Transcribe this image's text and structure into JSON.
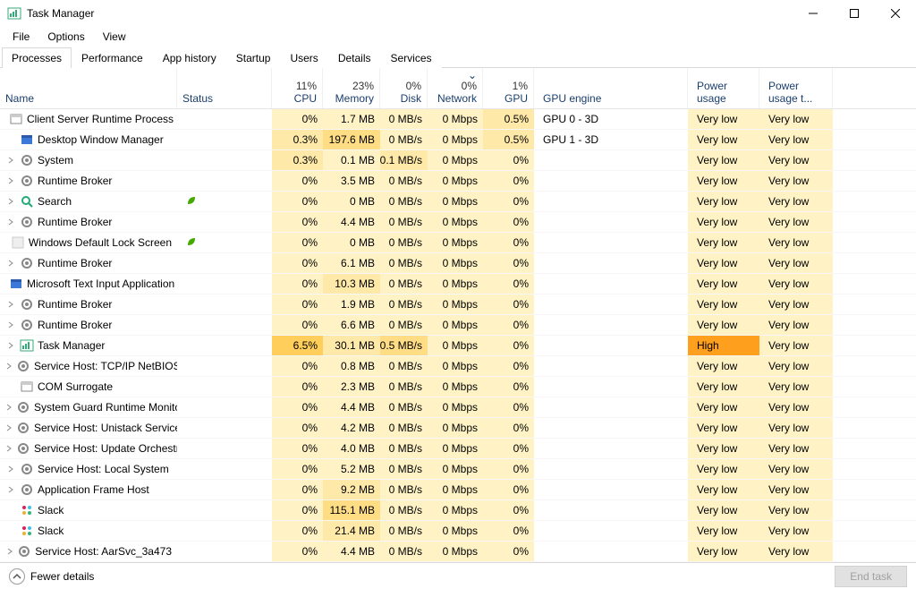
{
  "window": {
    "title": "Task Manager"
  },
  "menu": {
    "file": "File",
    "options": "Options",
    "view": "View"
  },
  "tabs": {
    "processes": "Processes",
    "performance": "Performance",
    "app_history": "App history",
    "startup": "Startup",
    "users": "Users",
    "details": "Details",
    "services": "Services"
  },
  "columns": {
    "name": "Name",
    "status": "Status",
    "cpu_pct": "11%",
    "cpu": "CPU",
    "mem_pct": "23%",
    "mem": "Memory",
    "disk_pct": "0%",
    "disk": "Disk",
    "net_pct": "0%",
    "net": "Network",
    "gpu_pct": "1%",
    "gpu": "GPU",
    "gpu_engine": "GPU engine",
    "power": "Power usage",
    "power_trend": "Power usage t..."
  },
  "footer": {
    "fewer": "Fewer details",
    "end_task": "End task"
  },
  "processes": [
    {
      "expand": false,
      "icon": "window",
      "name": "Client Server Runtime Process",
      "leaf": "",
      "cpu": "0%",
      "mem": "1.7 MB",
      "disk": "0 MB/s",
      "net": "0 Mbps",
      "gpu": "0.5%",
      "gpueng": "GPU 0 - 3D",
      "power": "Very low",
      "powertrend": "Very low",
      "cpu_h": 1,
      "mem_h": 1,
      "disk_h": 1,
      "net_h": 1,
      "gpu_h": 2,
      "power_h": 1
    },
    {
      "expand": false,
      "icon": "window-blue",
      "name": "Desktop Window Manager",
      "leaf": "",
      "cpu": "0.3%",
      "mem": "197.6 MB",
      "disk": "0 MB/s",
      "net": "0 Mbps",
      "gpu": "0.5%",
      "gpueng": "GPU 1 - 3D",
      "power": "Very low",
      "powertrend": "Very low",
      "cpu_h": 2,
      "mem_h": 3,
      "disk_h": 1,
      "net_h": 1,
      "gpu_h": 2,
      "power_h": 1
    },
    {
      "expand": true,
      "icon": "gear",
      "name": "System",
      "leaf": "",
      "cpu": "0.3%",
      "mem": "0.1 MB",
      "disk": "0.1 MB/s",
      "net": "0 Mbps",
      "gpu": "0%",
      "gpueng": "",
      "power": "Very low",
      "powertrend": "Very low",
      "cpu_h": 2,
      "mem_h": 1,
      "disk_h": 2,
      "net_h": 1,
      "gpu_h": 1,
      "power_h": 1
    },
    {
      "expand": true,
      "icon": "gear",
      "name": "Runtime Broker",
      "leaf": "",
      "cpu": "0%",
      "mem": "3.5 MB",
      "disk": "0 MB/s",
      "net": "0 Mbps",
      "gpu": "0%",
      "gpueng": "",
      "power": "Very low",
      "powertrend": "Very low",
      "cpu_h": 1,
      "mem_h": 1,
      "disk_h": 1,
      "net_h": 1,
      "gpu_h": 1,
      "power_h": 1
    },
    {
      "expand": true,
      "icon": "search",
      "name": "Search",
      "leaf": "green",
      "cpu": "0%",
      "mem": "0 MB",
      "disk": "0 MB/s",
      "net": "0 Mbps",
      "gpu": "0%",
      "gpueng": "",
      "power": "Very low",
      "powertrend": "Very low",
      "cpu_h": 1,
      "mem_h": 1,
      "disk_h": 1,
      "net_h": 1,
      "gpu_h": 1,
      "power_h": 1
    },
    {
      "expand": true,
      "icon": "gear",
      "name": "Runtime Broker",
      "leaf": "",
      "cpu": "0%",
      "mem": "4.4 MB",
      "disk": "0 MB/s",
      "net": "0 Mbps",
      "gpu": "0%",
      "gpueng": "",
      "power": "Very low",
      "powertrend": "Very low",
      "cpu_h": 1,
      "mem_h": 1,
      "disk_h": 1,
      "net_h": 1,
      "gpu_h": 1,
      "power_h": 1
    },
    {
      "expand": false,
      "icon": "blank",
      "name": "Windows Default Lock Screen",
      "leaf": "green",
      "cpu": "0%",
      "mem": "0 MB",
      "disk": "0 MB/s",
      "net": "0 Mbps",
      "gpu": "0%",
      "gpueng": "",
      "power": "Very low",
      "powertrend": "Very low",
      "cpu_h": 1,
      "mem_h": 1,
      "disk_h": 1,
      "net_h": 1,
      "gpu_h": 1,
      "power_h": 1
    },
    {
      "expand": true,
      "icon": "gear",
      "name": "Runtime Broker",
      "leaf": "",
      "cpu": "0%",
      "mem": "6.1 MB",
      "disk": "0 MB/s",
      "net": "0 Mbps",
      "gpu": "0%",
      "gpueng": "",
      "power": "Very low",
      "powertrend": "Very low",
      "cpu_h": 1,
      "mem_h": 1,
      "disk_h": 1,
      "net_h": 1,
      "gpu_h": 1,
      "power_h": 1
    },
    {
      "expand": false,
      "icon": "window-blue",
      "name": "Microsoft Text Input Application",
      "leaf": "",
      "cpu": "0%",
      "mem": "10.3 MB",
      "disk": "0 MB/s",
      "net": "0 Mbps",
      "gpu": "0%",
      "gpueng": "",
      "power": "Very low",
      "powertrend": "Very low",
      "cpu_h": 1,
      "mem_h": 2,
      "disk_h": 1,
      "net_h": 1,
      "gpu_h": 1,
      "power_h": 1
    },
    {
      "expand": true,
      "icon": "gear",
      "name": "Runtime Broker",
      "leaf": "",
      "cpu": "0%",
      "mem": "1.9 MB",
      "disk": "0 MB/s",
      "net": "0 Mbps",
      "gpu": "0%",
      "gpueng": "",
      "power": "Very low",
      "powertrend": "Very low",
      "cpu_h": 1,
      "mem_h": 1,
      "disk_h": 1,
      "net_h": 1,
      "gpu_h": 1,
      "power_h": 1
    },
    {
      "expand": true,
      "icon": "gear",
      "name": "Runtime Broker",
      "leaf": "",
      "cpu": "0%",
      "mem": "6.6 MB",
      "disk": "0 MB/s",
      "net": "0 Mbps",
      "gpu": "0%",
      "gpueng": "",
      "power": "Very low",
      "powertrend": "Very low",
      "cpu_h": 1,
      "mem_h": 1,
      "disk_h": 1,
      "net_h": 1,
      "gpu_h": 1,
      "power_h": 1
    },
    {
      "expand": true,
      "icon": "taskmgr",
      "name": "Task Manager",
      "leaf": "",
      "cpu": "6.5%",
      "mem": "30.1 MB",
      "disk": "0.5 MB/s",
      "net": "0 Mbps",
      "gpu": "0%",
      "gpueng": "",
      "power": "High",
      "powertrend": "Very low",
      "cpu_h": 4,
      "mem_h": 2,
      "disk_h": 3,
      "net_h": 1,
      "gpu_h": 1,
      "power_h": "high"
    },
    {
      "expand": true,
      "icon": "gear",
      "name": "Service Host: TCP/IP NetBIOS H...",
      "leaf": "",
      "cpu": "0%",
      "mem": "0.8 MB",
      "disk": "0 MB/s",
      "net": "0 Mbps",
      "gpu": "0%",
      "gpueng": "",
      "power": "Very low",
      "powertrend": "Very low",
      "cpu_h": 1,
      "mem_h": 1,
      "disk_h": 1,
      "net_h": 1,
      "gpu_h": 1,
      "power_h": 1
    },
    {
      "expand": false,
      "icon": "window",
      "name": "COM Surrogate",
      "leaf": "",
      "cpu": "0%",
      "mem": "2.3 MB",
      "disk": "0 MB/s",
      "net": "0 Mbps",
      "gpu": "0%",
      "gpueng": "",
      "power": "Very low",
      "powertrend": "Very low",
      "cpu_h": 1,
      "mem_h": 1,
      "disk_h": 1,
      "net_h": 1,
      "gpu_h": 1,
      "power_h": 1
    },
    {
      "expand": true,
      "icon": "gear",
      "name": "System Guard Runtime Monitor...",
      "leaf": "",
      "cpu": "0%",
      "mem": "4.4 MB",
      "disk": "0 MB/s",
      "net": "0 Mbps",
      "gpu": "0%",
      "gpueng": "",
      "power": "Very low",
      "powertrend": "Very low",
      "cpu_h": 1,
      "mem_h": 1,
      "disk_h": 1,
      "net_h": 1,
      "gpu_h": 1,
      "power_h": 1
    },
    {
      "expand": true,
      "icon": "gear",
      "name": "Service Host: Unistack Service G...",
      "leaf": "",
      "cpu": "0%",
      "mem": "4.2 MB",
      "disk": "0 MB/s",
      "net": "0 Mbps",
      "gpu": "0%",
      "gpueng": "",
      "power": "Very low",
      "powertrend": "Very low",
      "cpu_h": 1,
      "mem_h": 1,
      "disk_h": 1,
      "net_h": 1,
      "gpu_h": 1,
      "power_h": 1
    },
    {
      "expand": true,
      "icon": "gear",
      "name": "Service Host: Update Orchestrat...",
      "leaf": "",
      "cpu": "0%",
      "mem": "4.0 MB",
      "disk": "0 MB/s",
      "net": "0 Mbps",
      "gpu": "0%",
      "gpueng": "",
      "power": "Very low",
      "powertrend": "Very low",
      "cpu_h": 1,
      "mem_h": 1,
      "disk_h": 1,
      "net_h": 1,
      "gpu_h": 1,
      "power_h": 1
    },
    {
      "expand": true,
      "icon": "gear",
      "name": "Service Host: Local System",
      "leaf": "",
      "cpu": "0%",
      "mem": "5.2 MB",
      "disk": "0 MB/s",
      "net": "0 Mbps",
      "gpu": "0%",
      "gpueng": "",
      "power": "Very low",
      "powertrend": "Very low",
      "cpu_h": 1,
      "mem_h": 1,
      "disk_h": 1,
      "net_h": 1,
      "gpu_h": 1,
      "power_h": 1
    },
    {
      "expand": true,
      "icon": "gear",
      "name": "Application Frame Host",
      "leaf": "",
      "cpu": "0%",
      "mem": "9.2 MB",
      "disk": "0 MB/s",
      "net": "0 Mbps",
      "gpu": "0%",
      "gpueng": "",
      "power": "Very low",
      "powertrend": "Very low",
      "cpu_h": 1,
      "mem_h": 2,
      "disk_h": 1,
      "net_h": 1,
      "gpu_h": 1,
      "power_h": 1
    },
    {
      "expand": false,
      "icon": "slack",
      "name": "Slack",
      "leaf": "",
      "cpu": "0%",
      "mem": "115.1 MB",
      "disk": "0 MB/s",
      "net": "0 Mbps",
      "gpu": "0%",
      "gpueng": "",
      "power": "Very low",
      "powertrend": "Very low",
      "cpu_h": 1,
      "mem_h": 3,
      "disk_h": 1,
      "net_h": 1,
      "gpu_h": 1,
      "power_h": 1
    },
    {
      "expand": false,
      "icon": "slack",
      "name": "Slack",
      "leaf": "",
      "cpu": "0%",
      "mem": "21.4 MB",
      "disk": "0 MB/s",
      "net": "0 Mbps",
      "gpu": "0%",
      "gpueng": "",
      "power": "Very low",
      "powertrend": "Very low",
      "cpu_h": 1,
      "mem_h": 2,
      "disk_h": 1,
      "net_h": 1,
      "gpu_h": 1,
      "power_h": 1
    },
    {
      "expand": true,
      "icon": "gear",
      "name": "Service Host: AarSvc_3a473",
      "leaf": "",
      "cpu": "0%",
      "mem": "4.4 MB",
      "disk": "0 MB/s",
      "net": "0 Mbps",
      "gpu": "0%",
      "gpueng": "",
      "power": "Very low",
      "powertrend": "Very low",
      "cpu_h": 1,
      "mem_h": 1,
      "disk_h": 1,
      "net_h": 1,
      "gpu_h": 1,
      "power_h": 1
    }
  ]
}
